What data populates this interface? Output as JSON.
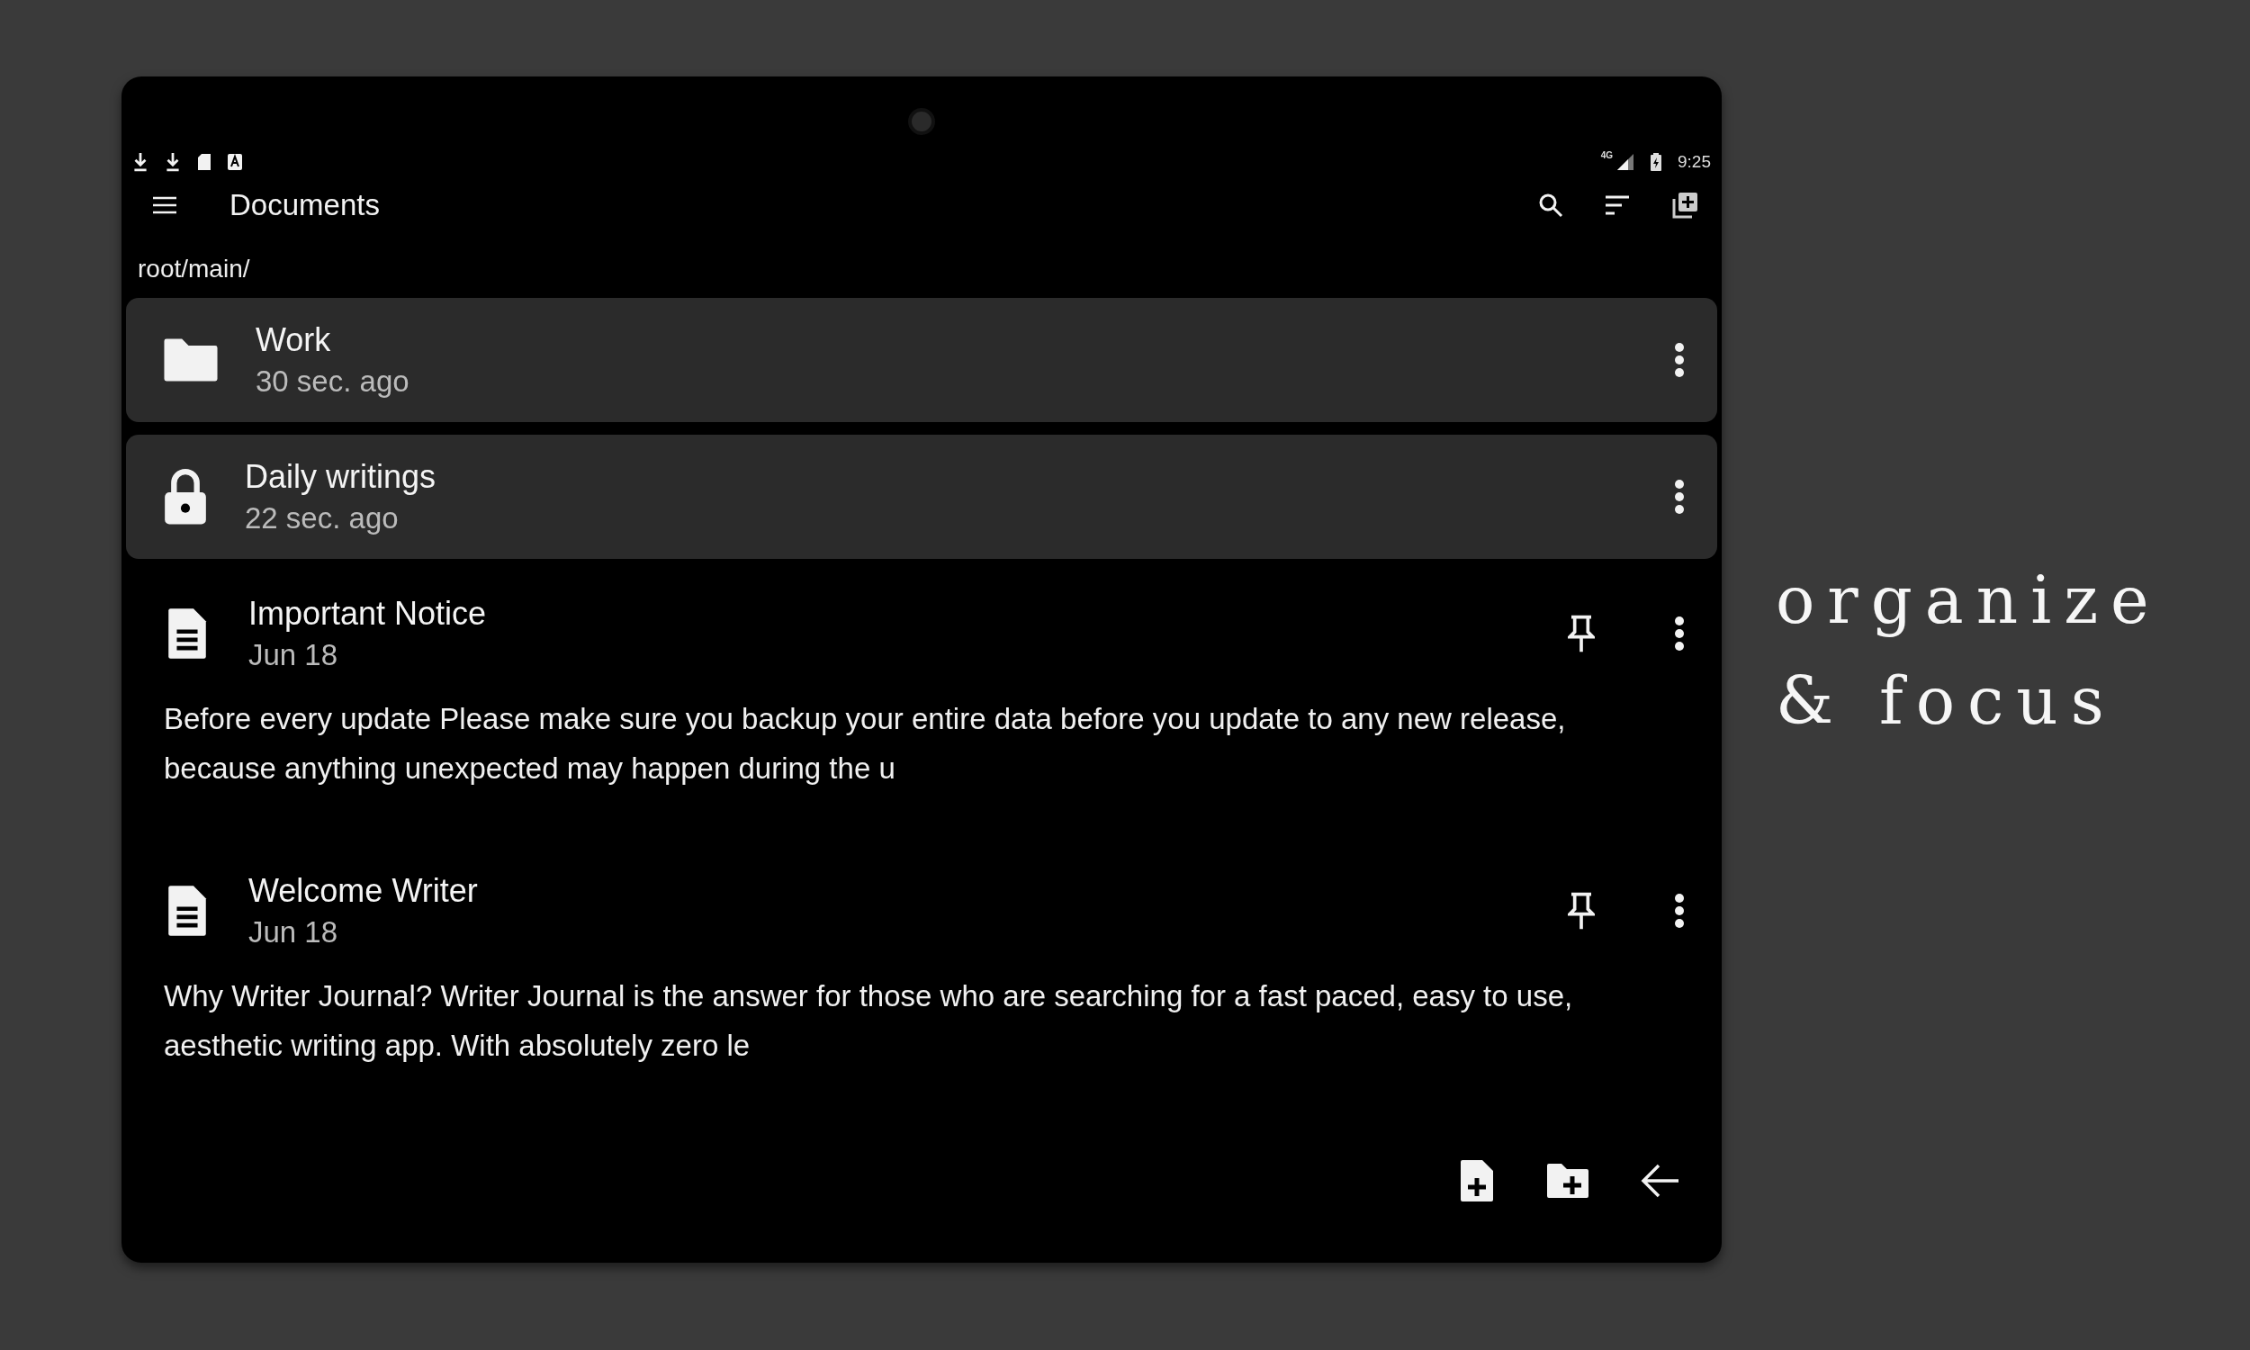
{
  "status_bar": {
    "time": "9:25",
    "network": "4G"
  },
  "toolbar": {
    "title": "Documents"
  },
  "path": "root/main/",
  "items": [
    {
      "kind": "folder",
      "title": "Work",
      "subtitle": "30 sec. ago"
    },
    {
      "kind": "locked",
      "title": "Daily writings",
      "subtitle": "22 sec. ago"
    },
    {
      "kind": "note",
      "title": "Important Notice",
      "subtitle": "Jun 18",
      "pinned": true,
      "preview": "Before every update Please make sure you backup your entire data before you update to any new release, because anything unexpected may happen during the u"
    },
    {
      "kind": "note",
      "title": "Welcome Writer",
      "subtitle": "Jun 18",
      "pinned": true,
      "preview": "Why Writer Journal? Writer Journal is the answer for those who are searching for a fast paced, easy to use, aesthetic writing app. With absolutely zero le"
    }
  ],
  "caption": [
    "organize",
    "& focus"
  ]
}
